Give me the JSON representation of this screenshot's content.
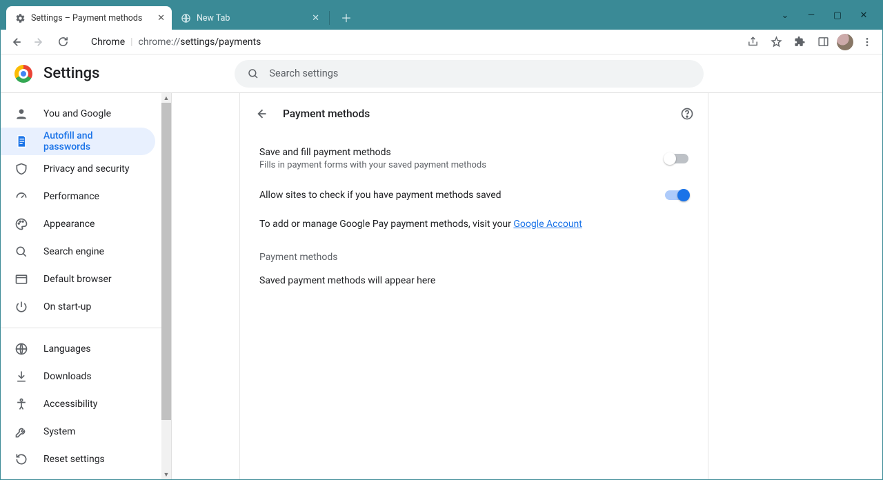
{
  "window": {
    "tabs": [
      {
        "title": "Settings – Payment methods"
      },
      {
        "title": "New Tab"
      }
    ]
  },
  "omnibox": {
    "scheme_host": "Chrome",
    "url_prefix": "chrome://",
    "url_path": "settings/payments"
  },
  "header": {
    "title": "Settings",
    "search_placeholder": "Search settings"
  },
  "sidebar": {
    "items": [
      {
        "label": "You and Google"
      },
      {
        "label": "Autofill and passwords"
      },
      {
        "label": "Privacy and security"
      },
      {
        "label": "Performance"
      },
      {
        "label": "Appearance"
      },
      {
        "label": "Search engine"
      },
      {
        "label": "Default browser"
      },
      {
        "label": "On start-up"
      }
    ],
    "items2": [
      {
        "label": "Languages"
      },
      {
        "label": "Downloads"
      },
      {
        "label": "Accessibility"
      },
      {
        "label": "System"
      },
      {
        "label": "Reset settings"
      }
    ],
    "active_index": 1
  },
  "page": {
    "title": "Payment methods",
    "rows": {
      "save_fill": {
        "title": "Save and fill payment methods",
        "subtitle": "Fills in payment forms with your saved payment methods",
        "enabled": false
      },
      "allow_check": {
        "title": "Allow sites to check if you have payment methods saved",
        "enabled": true
      }
    },
    "gpay_prefix": "To add or manage Google Pay payment methods, visit your ",
    "gpay_link": "Google Account",
    "section_label": "Payment methods",
    "empty_text": "Saved payment methods will appear here"
  }
}
